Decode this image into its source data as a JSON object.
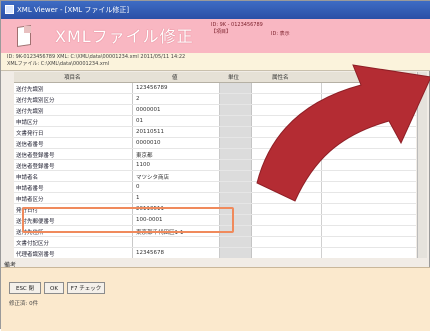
{
  "window": {
    "title": "XML Viewer - [XML ファイル修正]"
  },
  "header": {
    "title": "XMLファイル修正",
    "meta_line1": "ID: 9K - 0123456789",
    "meta_line2": "【項目】",
    "meta_line3": "ID: 表示"
  },
  "info": {
    "line1": "ID: 9K-0123456789  XML: C:\\XML\\data\\00001234.xml  2011/05/11 14:22",
    "line2": "XMLファイル: C:\\XML\\data\\00001234.xml"
  },
  "grid": {
    "columns": [
      "項目名",
      "値",
      "単位",
      "属性名",
      "属性値"
    ],
    "rows": [
      {
        "name": "送付先識別",
        "value": "123456789"
      },
      {
        "name": "送付先識別区分",
        "value": "2"
      },
      {
        "name": "送付先識別",
        "value": "0000001"
      },
      {
        "name": "申請区分",
        "value": "01"
      },
      {
        "name": "文書発行日",
        "value": "20110511"
      },
      {
        "name": "送信者番号",
        "value": "0000010"
      },
      {
        "name": "送信者登録番号",
        "value": "東京都"
      },
      {
        "name": "送信者登録番号",
        "value": "1100"
      },
      {
        "name": "申請者名",
        "value": "マツシタ商店"
      },
      {
        "name": "申請者番号",
        "value": "0"
      },
      {
        "name": "申請者区分",
        "value": "1"
      },
      {
        "name": "発行日付",
        "value": "20110511"
      },
      {
        "name": "送付先郵便番号",
        "value": "100-0001"
      },
      {
        "name": "送付先住所",
        "value": "東京都千代田区1-1"
      },
      {
        "name": "文書付記区分",
        "value": ""
      },
      {
        "name": "代理者識別番号",
        "value": "12345678"
      }
    ]
  },
  "remark": {
    "label": "備考"
  },
  "buttons": {
    "esc": "ESC 閉",
    "ok": "OK",
    "check": "F7 チェック"
  },
  "footer": {
    "text": "修正済: 0件"
  },
  "colors": {
    "header": "#f9b7c2",
    "arrow": "#b42c33",
    "highlight": "#f08a5c"
  }
}
